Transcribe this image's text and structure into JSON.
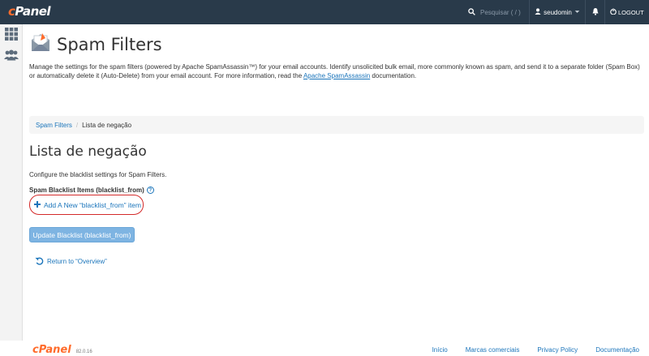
{
  "topbar": {
    "logo_main": "Panel",
    "logo_c": "c",
    "search_placeholder": "Pesquisar ( / )",
    "username": "seudomin",
    "logout": "LOGOUT"
  },
  "sidebar": {
    "items": [
      {
        "icon": "grid-icon"
      },
      {
        "icon": "users-icon"
      }
    ]
  },
  "page": {
    "title": "Spam Filters",
    "intro_text": "Manage the settings for the spam filters (powered by Apache SpamAssassin™) for your email accounts. Identify unsolicited bulk email, more commonly known as spam, and send it to a separate folder (Spam Box) or automatically delete it (Auto-Delete) from your email account. For more information, read the ",
    "intro_link": "Apache SpamAssassin",
    "intro_end": " documentation."
  },
  "breadcrumb": {
    "parent": "Spam Filters",
    "separator": "/",
    "current": "Lista de negação"
  },
  "section": {
    "title": "Lista de negação",
    "description": "Configure the blacklist settings for Spam Filters.",
    "field_label": "Spam Blacklist Items (blacklist_from)",
    "help": "?",
    "add_link": "Add A New “blacklist_from” item",
    "update_button": "Update Blacklist (blacklist_from)",
    "return_link": "Return to “Overview”"
  },
  "footer": {
    "brand": "cPanel",
    "version": "82.0.16",
    "links": [
      "Início",
      "Marcas comerciais",
      "Privacy Policy",
      "Documentação"
    ]
  },
  "colors": {
    "topbar": "#293a4a",
    "accent": "#ff6c2c",
    "link": "#1b75bb",
    "highlight": "#d42a2a",
    "button": "#7eb4e2"
  }
}
